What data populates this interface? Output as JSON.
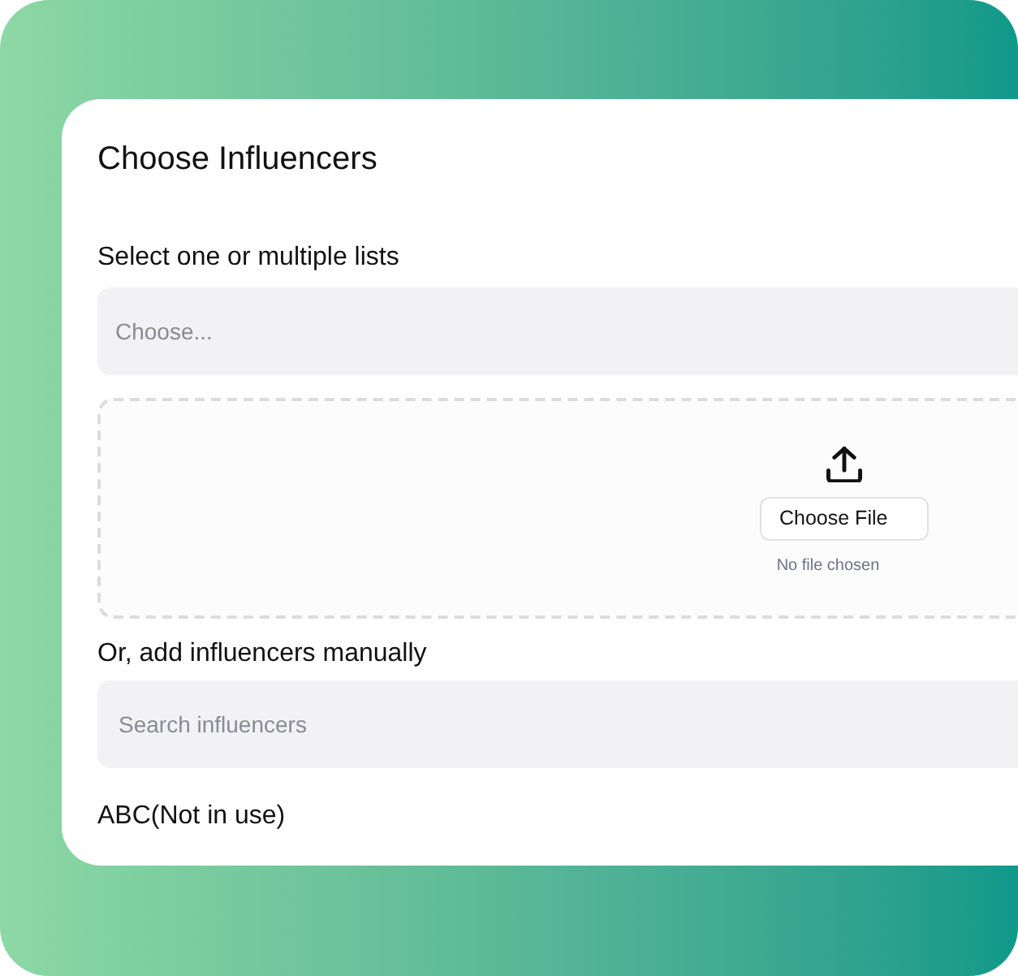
{
  "dialog": {
    "title": "Choose Influencers"
  },
  "lists": {
    "label": "Select one or multiple lists",
    "placeholder": "Choose..."
  },
  "upload": {
    "button": "Choose File",
    "status": "No file chosen"
  },
  "manual": {
    "label": "Or, add influencers manually",
    "placeholder": "Search influencers"
  },
  "section_3": {
    "label": "ABC(Not in use)"
  }
}
